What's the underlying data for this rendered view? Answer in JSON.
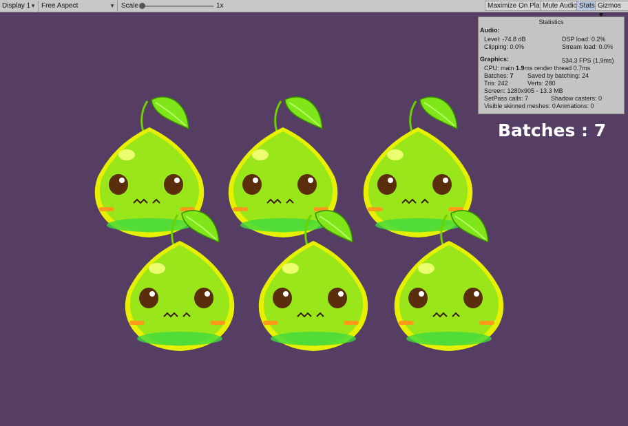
{
  "toolbar": {
    "display": "Display 1",
    "aspect": "Free Aspect",
    "scale_label": "Scale",
    "scale_value": "1x",
    "maximize": "Maximize On Play",
    "mute": "Mute Audio",
    "stats": "Stats",
    "gizmos": "Gizmos"
  },
  "stats": {
    "title": "Statistics",
    "audio_header": "Audio:",
    "level": "Level: -74.8 dB",
    "dsp": "DSP load: 0.2%",
    "clipping": "Clipping: 0.0%",
    "stream": "Stream load: 0.0%",
    "graphics_header": "Graphics:",
    "fps": "534.3 FPS (1.9ms)",
    "cpu_prefix": "CPU: main",
    "cpu_main": "1.9",
    "cpu_suffix": "ms  render thread 0.7ms",
    "batches_prefix": "Batches:",
    "batches_value": "7",
    "saved": "Saved by batching: 24",
    "tris": "Tris: 242",
    "verts": "Verts: 280",
    "screen": "Screen: 1280x905 - 13.3 MB",
    "setpass": "SetPass calls: 7",
    "shadow": "Shadow casters: 0",
    "skinned": "Visible skinned meshes: 0",
    "animations": "Animations: 0"
  },
  "overlay_label": "Batches : 7",
  "colors": {
    "background": "#553d64",
    "slime_body": "#99e61a",
    "slime_outline": "#e6f000",
    "leaf": "#7fe61a"
  }
}
